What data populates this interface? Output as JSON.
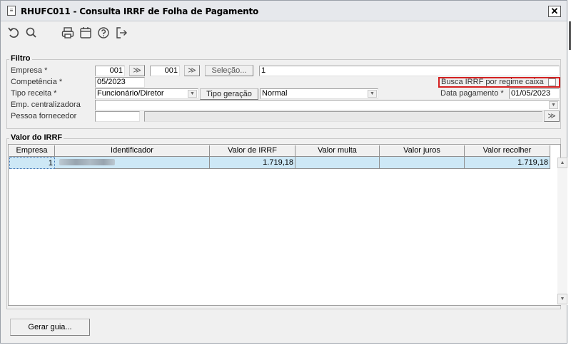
{
  "window": {
    "title": "RHUFC011 - Consulta IRRF de Folha de Pagamento",
    "close_label": "✕"
  },
  "toolbar": {
    "icons": [
      "undo-icon",
      "search-icon",
      "print-icon",
      "calendar-icon",
      "help-icon",
      "exit-icon"
    ]
  },
  "filtro": {
    "title": "Filtro",
    "empresa": {
      "label": "Empresa *",
      "from": "001",
      "to": "001",
      "selecao_label": "Seleção...",
      "value": "1"
    },
    "competencia": {
      "label": "Competência *",
      "value": "05/2023"
    },
    "busca_irrf": {
      "label": "Busca IRRF por regime caixa",
      "checked": false
    },
    "tipo_receita": {
      "label": "Tipo receita *",
      "value": "Funcionário/Diretor"
    },
    "tipo_geracao": {
      "label": "Tipo geração",
      "value": "Normal"
    },
    "data_pagamento": {
      "label": "Data pagamento *",
      "value": "01/05/2023"
    },
    "emp_centralizadora": {
      "label": "Emp. centralizadora",
      "value": ""
    },
    "pessoa_fornecedor": {
      "label": "Pessoa fornecedor",
      "value": ""
    }
  },
  "valor_irrf": {
    "title": "Valor do IRRF",
    "columns": [
      "Empresa",
      "Identificador",
      "Valor de IRRF",
      "Valor multa",
      "Valor juros",
      "Valor recolher"
    ],
    "rows": [
      {
        "empresa": "1",
        "identificador": "",
        "valor_irrf": "1.719,18",
        "valor_multa": "",
        "valor_juros": "",
        "valor_recolher": "1.719,18"
      }
    ]
  },
  "footer": {
    "gerar_guia_label": "Gerar guia..."
  },
  "colors": {
    "selected_row": "#cde8f6",
    "highlight_border": "#d42020",
    "window_bg": "#f0f0f0"
  }
}
